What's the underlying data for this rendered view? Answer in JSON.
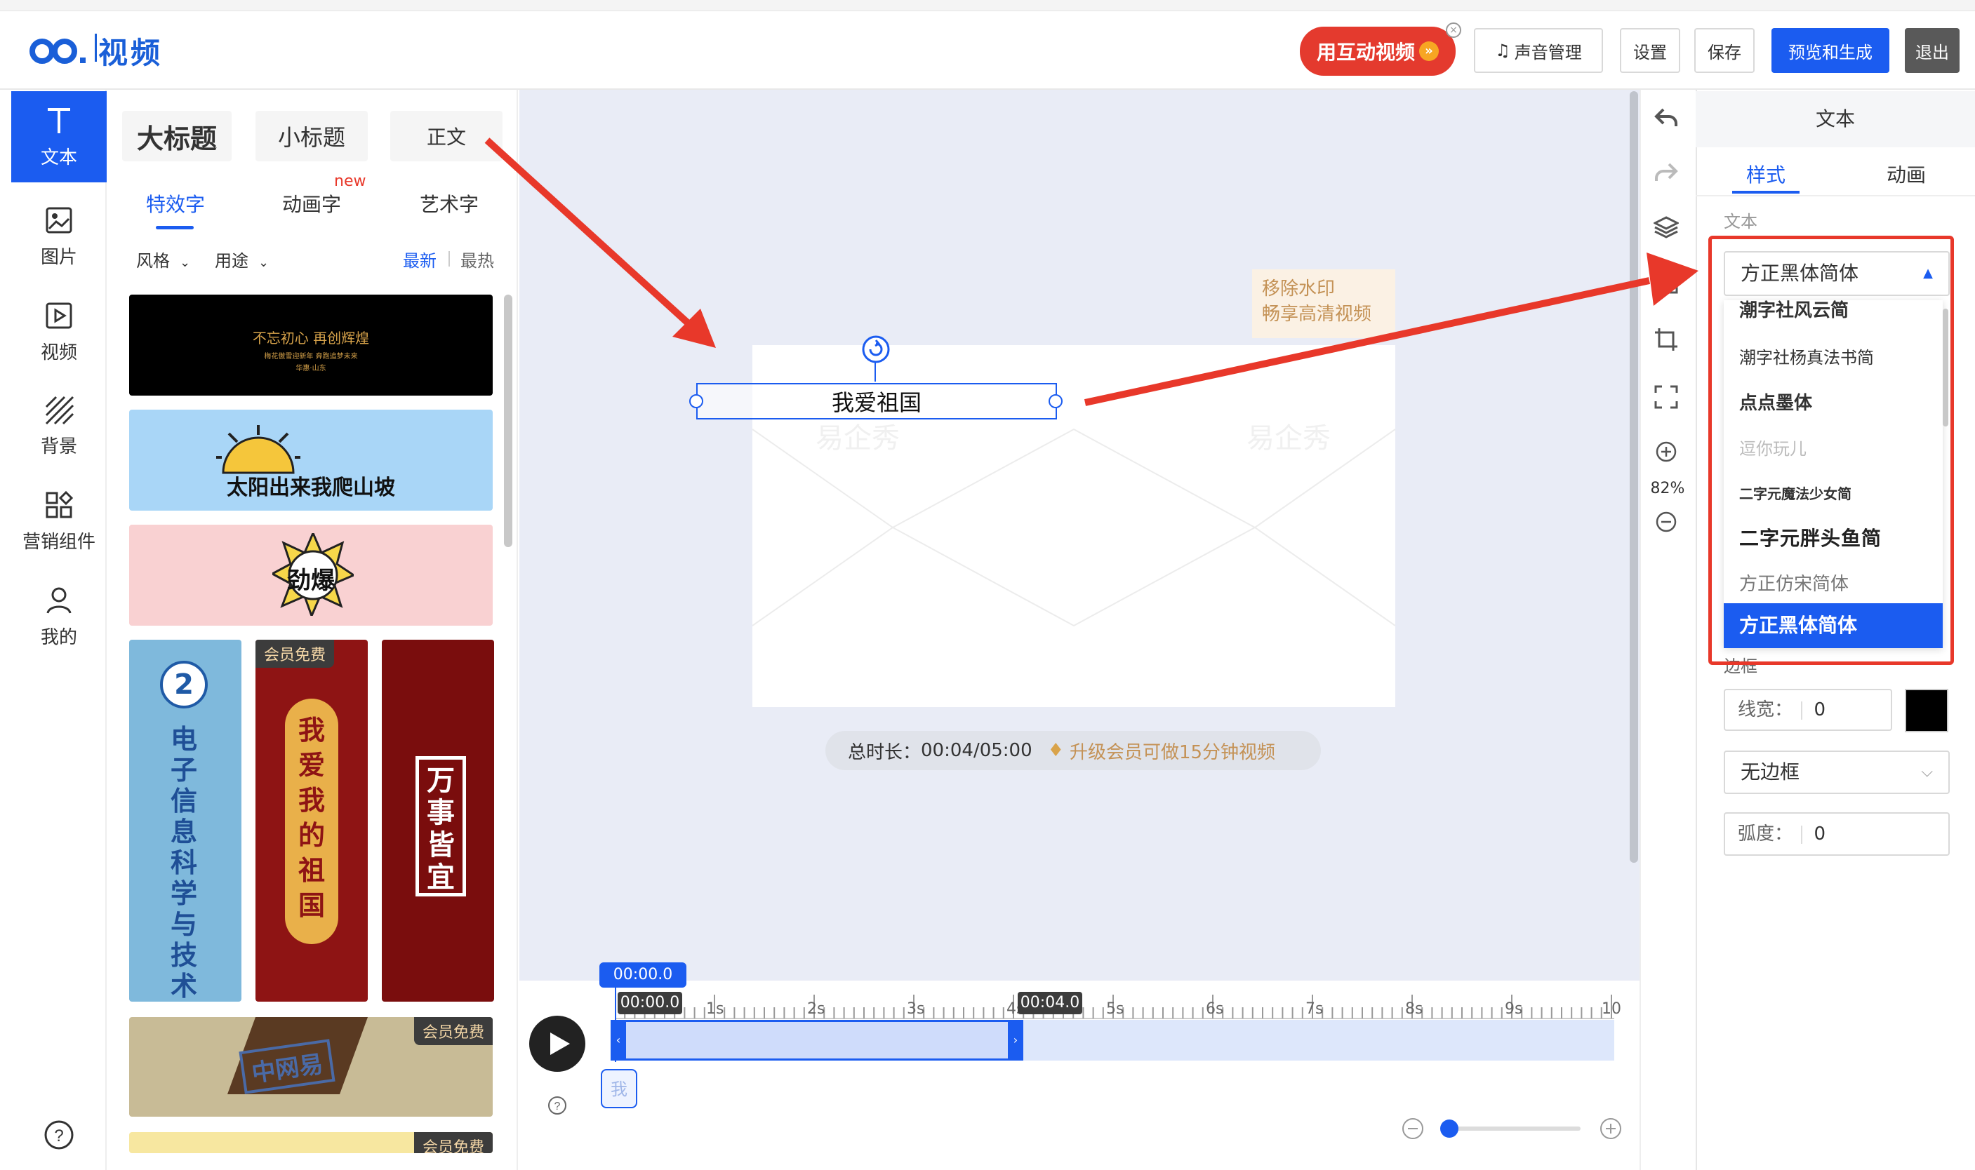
{
  "header": {
    "logo_text": "视频",
    "promo_label": "用互动视频",
    "buttons": {
      "voice": "声音管理",
      "settings": "设置",
      "save": "保存",
      "preview": "预览和生成",
      "exit": "退出"
    }
  },
  "left_rail": {
    "items": [
      {
        "label": "文本",
        "icon": "text-icon"
      },
      {
        "label": "图片",
        "icon": "image-icon"
      },
      {
        "label": "视频",
        "icon": "video-icon"
      },
      {
        "label": "背景",
        "icon": "background-icon"
      },
      {
        "label": "营销组件",
        "icon": "widgets-icon"
      },
      {
        "label": "我的",
        "icon": "user-icon"
      }
    ]
  },
  "text_panel": {
    "headings": {
      "title": "大标题",
      "subtitle": "小标题",
      "body": "正文"
    },
    "tabs": {
      "effect": "特效字",
      "animated": "动画字",
      "art": "艺术字",
      "new_badge": "new"
    },
    "filters": {
      "style": "风格",
      "usage": "用途",
      "latest": "最新",
      "hottest": "最热"
    },
    "cards": {
      "card1_line1": "不忘初心 再创辉煌",
      "card1_line2": "梅花傲雪迎新年 奔跑追梦未来",
      "card1_line3": "华惠·山东",
      "card2": "太阳出来我爬山坡",
      "card3": "劲爆",
      "card4_num": "2",
      "card4": "电子信息科学与技术",
      "card5": "我爱我的祖国",
      "card6": "万事皆宜",
      "card7": "中网易",
      "vip": "会员免费"
    }
  },
  "canvas": {
    "text_element": "我爱祖国",
    "watermark_line1": "移除水印",
    "watermark_line2": "畅享高清视频",
    "watermark_faint": "易企秀",
    "duration_label": "总时长：",
    "duration_value": "00:04/05:00",
    "upgrade": "升级会员可做15分钟视频"
  },
  "timeline": {
    "playhead": "00:00.0",
    "start_time": "00:00.0",
    "end_time": "00:04.0",
    "ticks": [
      "1s",
      "2s",
      "3s",
      "4s",
      "5s",
      "6s",
      "7s",
      "8s",
      "9s",
      "10"
    ],
    "track_label": "我",
    "zoom_progress": 0
  },
  "vertical_tools": {
    "zoom_value": "82%"
  },
  "right_panel": {
    "title": "文本",
    "tabs": {
      "style": "样式",
      "animation": "动画"
    },
    "section_text": "文本",
    "font_selected": "方正黑体简体",
    "font_options": [
      "潮字社风云简",
      "潮字社杨真法书简",
      "点点墨体",
      "逗你玩儿",
      "二字元魔法少女简",
      "二字元胖头鱼简",
      "方正仿宋简体",
      "方正黑体简体"
    ],
    "border_section": "边框",
    "line_width_label": "线宽：",
    "line_width_value": "0",
    "border_color": "#000000",
    "border_style": "无边框",
    "radius_label": "弧度：",
    "radius_value": "0"
  },
  "colors": {
    "accent": "#1b5cf0",
    "annotation_red": "#e8382a"
  }
}
